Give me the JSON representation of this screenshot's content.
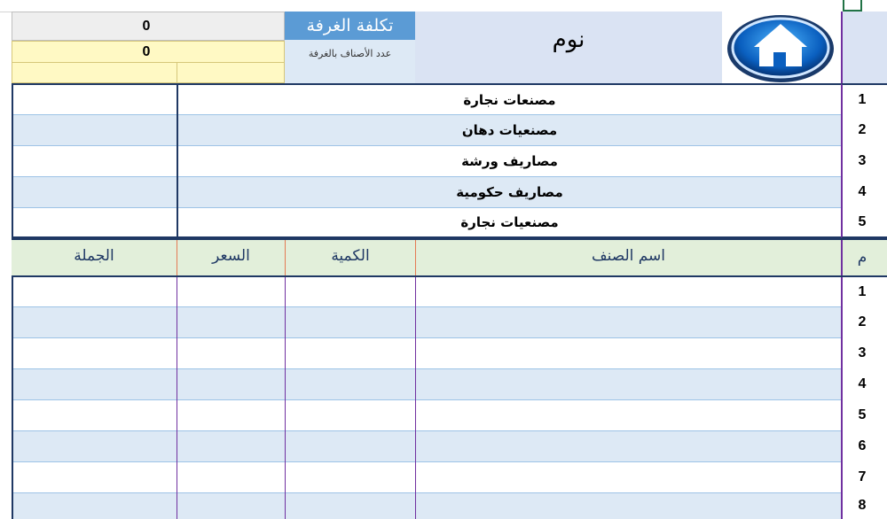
{
  "header": {
    "total_value": "0",
    "count_value": "0",
    "cost_label": "تكلفة الغرفة",
    "count_label": "عدد الأصناف بالغرفة",
    "room_name": "نوم",
    "logo_icon": "house-icon"
  },
  "categories": [
    {
      "index": "1",
      "name": "مصنعات نجارة"
    },
    {
      "index": "2",
      "name": "مصنعيات دهان"
    },
    {
      "index": "3",
      "name": "مصاريف ورشة"
    },
    {
      "index": "4",
      "name": "مصاريف حكومية"
    },
    {
      "index": "5",
      "name": "مصنعيات نجارة"
    }
  ],
  "table": {
    "headers": {
      "index": "م",
      "item_name": "اسم الصنف",
      "quantity": "الكمية",
      "price": "السعر",
      "total": "الجملة"
    },
    "rows": [
      "1",
      "2",
      "3",
      "4",
      "5",
      "6",
      "7",
      "8"
    ]
  },
  "colors": {
    "header_blue": "#5b9bd5",
    "room_bg": "#dae3f3",
    "yellow": "#fff9c4",
    "band_blue": "#dde9f5",
    "header_green": "#e2efda",
    "frame_navy": "#1f3864",
    "purple_line": "#7030a0"
  }
}
